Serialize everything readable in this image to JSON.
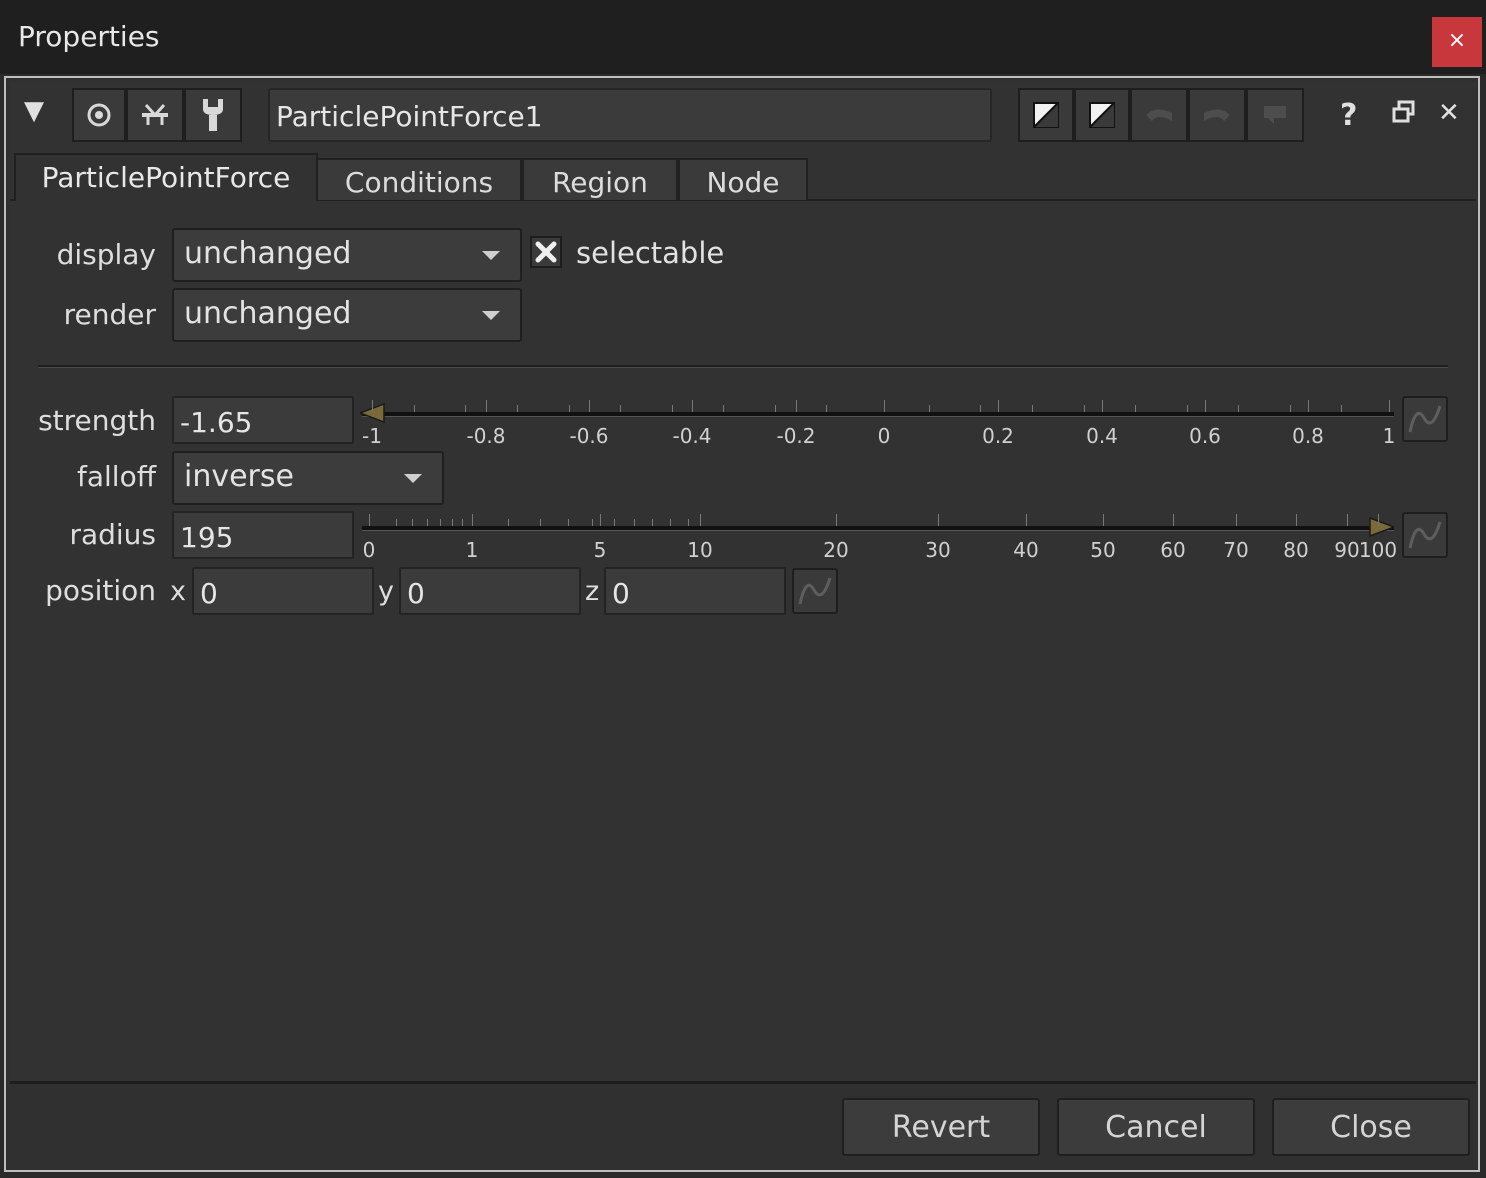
{
  "window": {
    "title": "Properties",
    "close_glyph": "×"
  },
  "toolbar": {
    "collapse_glyph": "▼",
    "node_name": "ParticlePointForce1",
    "help_glyph": "?",
    "close_glyph": "✕"
  },
  "tabs": [
    {
      "label": "ParticlePointForce",
      "active": true
    },
    {
      "label": "Conditions"
    },
    {
      "label": "Region"
    },
    {
      "label": "Node"
    }
  ],
  "params": {
    "display": {
      "label": "display",
      "value": "unchanged"
    },
    "selectable": {
      "label": "selectable",
      "checked": true
    },
    "render": {
      "label": "render",
      "value": "unchanged"
    },
    "strength": {
      "label": "strength",
      "value": "-1.65",
      "slider_ticks": [
        "-1",
        "-0.8",
        "-0.6",
        "-0.4",
        "-0.2",
        "0",
        "0.2",
        "0.4",
        "0.6",
        "0.8",
        "1"
      ]
    },
    "falloff": {
      "label": "falloff",
      "value": "inverse"
    },
    "radius": {
      "label": "radius",
      "value": "195",
      "slider_ticks": [
        "0",
        "1",
        "5",
        "10",
        "20",
        "30",
        "40",
        "50",
        "60",
        "70",
        "80",
        "90",
        "100"
      ]
    },
    "position": {
      "label": "position",
      "x_label": "x",
      "x": "0",
      "y_label": "y",
      "y": "0",
      "z_label": "z",
      "z": "0"
    }
  },
  "footer": {
    "revert": "Revert",
    "cancel": "Cancel",
    "close": "Close"
  },
  "colors": {
    "accent_close": "#c8373c",
    "slider_marker": "#7a6a3a"
  }
}
